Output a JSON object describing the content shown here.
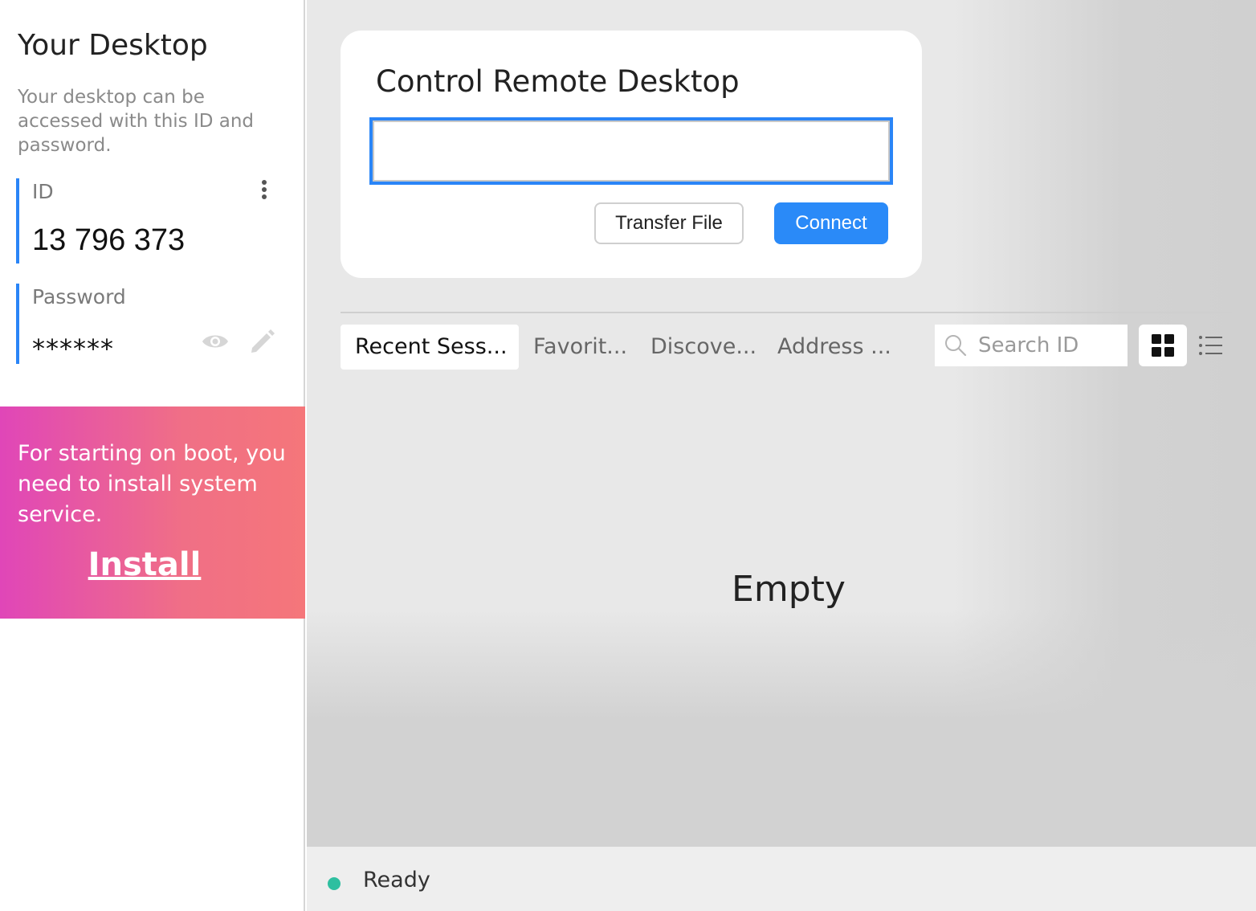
{
  "sidebar": {
    "title": "Your Desktop",
    "description": "Your desktop can be accessed with this ID and password.",
    "id_label": "ID",
    "id_value": "13 796 373",
    "password_label": "Password",
    "password_value": "******",
    "accent_color": "#2a85f7"
  },
  "install_banner": {
    "text": "For starting on boot, you need to install system service.",
    "link": "Install"
  },
  "connect_card": {
    "title": "Control Remote Desktop",
    "input_value": "",
    "transfer_button": "Transfer File",
    "connect_button": "Connect"
  },
  "tabs": [
    {
      "label": "Recent Sess...",
      "active": true
    },
    {
      "label": "Favorit...",
      "active": false
    },
    {
      "label": "Discove...",
      "active": false
    },
    {
      "label": "Address ...",
      "active": false
    }
  ],
  "search": {
    "placeholder": "Search ID"
  },
  "sessions": {
    "empty_text": "Empty"
  },
  "status": {
    "text": "Ready",
    "indicator_color": "#2ebfa0"
  },
  "icons": [
    "more-vertical-icon",
    "eye-icon",
    "pencil-icon",
    "search-icon",
    "grid-view-icon",
    "list-view-icon"
  ]
}
